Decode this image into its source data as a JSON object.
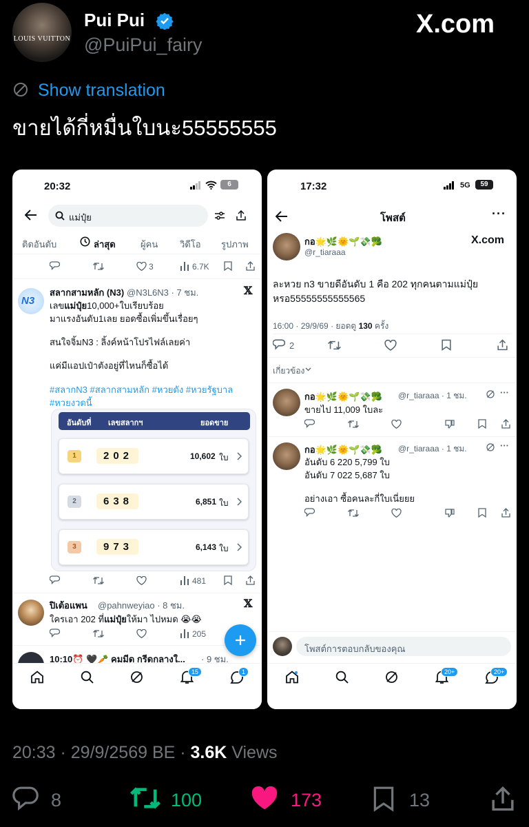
{
  "author": {
    "name": "Pui Pui",
    "handle": "@PuiPui_fairy",
    "avatar_text": "LOUIS VUITTON"
  },
  "watermark": "X.com",
  "translate_label": "Show translation",
  "tweet_text": "ขายได้กี่หมื่นใบนะ55555555",
  "left": {
    "time": "20:32",
    "battery": "6",
    "search": "แม่ปุ๋ย",
    "tabs": [
      "ติดอันดับ",
      "ล่าสุด",
      "ผู้คน",
      "วิดีโอ",
      "รูปภาพ"
    ],
    "top_stats": {
      "likes": "3",
      "views": "6.7K"
    },
    "post1": {
      "name": "สลากสามหลัก (N3)",
      "handle": "@N3L6N3 · 7 ชม.",
      "avatar": "N3",
      "line1a": "เลข",
      "line1b": "แม่ปุ๋ย",
      "line1c": "10,000+ใบเรียบร้อย",
      "line2": "มาแรงอันดับ1เลย ยอดซื้อเพิ่มขึ้นเรื่อยๆ",
      "line3": "สนใจจิ้มN3 : ลิ้งค์หน้าโปรไฟล์เลยค่า",
      "line4": "แค่มีแอปเป๋าตังอยู่ที่ไหนก็ซื้อได้",
      "tags1": "#สลากN3 #สลากสามหลัก #หวยดัง #หวยรัฐบาล",
      "tags2": "#หวยงวดนี้",
      "table": {
        "headers": [
          "อันดับที่",
          "เลขสลากฯ",
          "ยอดขาย"
        ],
        "rows": [
          {
            "rank": "1",
            "number": "202",
            "sales": "10,602",
            "unit": "ใบ"
          },
          {
            "rank": "2",
            "number": "638",
            "sales": "6,851",
            "unit": "ใบ"
          },
          {
            "rank": "3",
            "number": "973",
            "sales": "6,143",
            "unit": "ใบ"
          }
        ]
      },
      "views": "481"
    },
    "post2": {
      "name": "ปิเต้อแพน",
      "handle": "@pahnweyiao · 8 ชม.",
      "text_a": "ใครเอา 202 ที่",
      "text_b": "แม่ปุ๋ย",
      "text_c": "ให้มา ไปหมด 😭😭",
      "views": "205"
    },
    "post3": {
      "name": "10:10⏰ 🖤🥕 คมมีด กรีดกลางใ...",
      "handle": "· 9 ชม."
    },
    "nav_badges": {
      "notifications": "15",
      "messages": "1"
    }
  },
  "right": {
    "time": "17:32",
    "network": "5G",
    "battery": "59",
    "title": "โพสต์",
    "op": {
      "name": "กอ🌟🌿🌞🌱💸🥦",
      "handle": "@r_tiaraaa",
      "text1": "ละหวย n3 ขายดีอันดับ 1 คือ 202 ทุกคนตามแม่ปุ๋ย",
      "text2": "หรอ55555555555565",
      "meta_a": "16:00 · 29/9/69 · ยอดดู ",
      "meta_views": "130",
      "meta_b": " ครั้ง",
      "replies": "2"
    },
    "related": "เกี่ยวข้อง",
    "reply1": {
      "name": "กอ🌟🌿🌞🌱💸🥦",
      "handle": "@r_tiaraaa · 1 ชม.",
      "text": "ขายไป 11,009 ใบละ"
    },
    "reply2": {
      "name": "กอ🌟🌿🌞🌱💸🥦",
      "handle": "@r_tiaraaa · 1 ชม.",
      "line1": "อันดับ 6 220 5,799 ใบ",
      "line2": "อันดับ 7 022 5,687 ใบ",
      "line3": "อย่างเอา ซื้อคนละกี่ใบเนี่ยยย"
    },
    "reply_placeholder": "โพสต์การตอบกลับของคุณ",
    "nav_badges": {
      "notifications": "20+",
      "messages": "20+"
    }
  },
  "footer": {
    "time": "20:33 · 29/9/2569 BE · ",
    "views": "3.6K",
    "views_label": " Views"
  },
  "stats": {
    "replies": "8",
    "reposts": "100",
    "likes": "173",
    "bookmarks": "13"
  },
  "colors": {
    "accent": "#1d9bf0",
    "repost": "#00ba7c",
    "like": "#f91880",
    "table_header": "#2f4480"
  }
}
